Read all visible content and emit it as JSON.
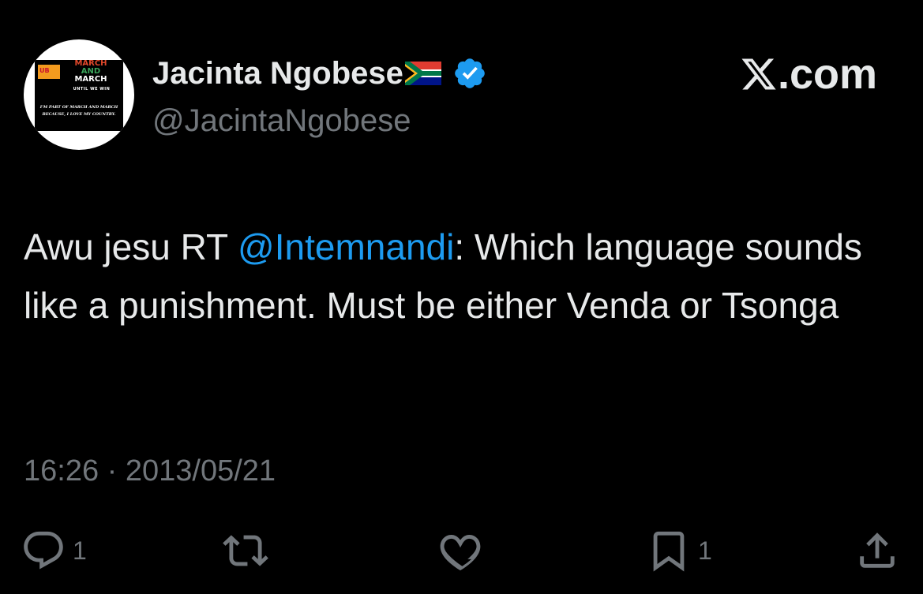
{
  "avatar": {
    "logo_text": "UB",
    "title_line1": "MARCH",
    "title_line2": "AND",
    "title_line3": "MARCH",
    "subtitle": "UNTIL WE WIN",
    "caption_line1": "I'M PART OF MARCH AND MARCH",
    "caption_line2": "BECAUSE, I LOVE MY COUNTRY."
  },
  "author": {
    "display_name": "Jacinta Ngobese",
    "handle": "@JacintaNgobese",
    "flag": "south-africa-flag",
    "verified": true
  },
  "brand": {
    "label": ".com",
    "logo": "x-logo"
  },
  "tweet": {
    "text_prefix": "Awu jesu RT ",
    "mention": "@Intemnandi",
    "text_suffix": ": Which language sounds like a punishment. Must be either Venda or Tsonga",
    "timestamp": "16:26 · 2013/05/21"
  },
  "actions": {
    "reply_count": "1",
    "retweet_count": "",
    "like_count": "",
    "bookmark_count": "1"
  },
  "colors": {
    "background": "#000000",
    "text": "#e7e9ea",
    "muted": "#71767b",
    "accent": "#1d9bf0"
  }
}
